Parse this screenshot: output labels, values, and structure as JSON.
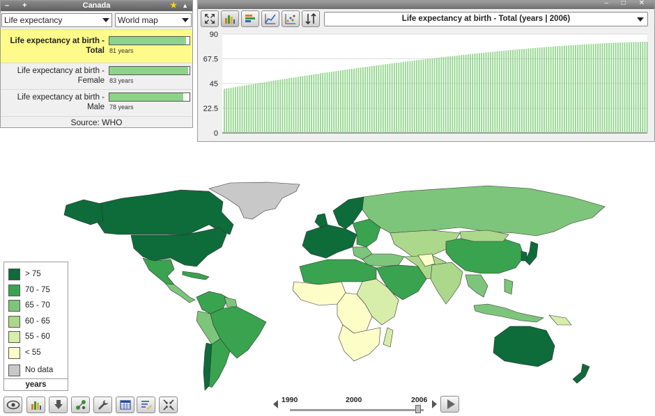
{
  "country_panel": {
    "title": "Canada",
    "indicator_select": "Life expectancy",
    "view_select": "World map",
    "indicators": [
      {
        "label_line1": "Life expectancy at birth -",
        "label_line2": "Total",
        "value_text": "81 years",
        "fill_fraction": 0.96,
        "selected": true
      },
      {
        "label_line1": "Life expectancy at birth -",
        "label_line2": "Female",
        "value_text": "83 years",
        "fill_fraction": 0.98,
        "selected": false
      },
      {
        "label_line1": "Life expectancy at birth -",
        "label_line2": "Male",
        "value_text": "78 years",
        "fill_fraction": 0.92,
        "selected": false
      }
    ],
    "source": "Source: WHO"
  },
  "chart_panel": {
    "title": "Life expectancy at birth - Total (years | 2006)",
    "tool_icons": [
      "fullscreen-icon",
      "bar-chart-icon",
      "horizontal-bar-icon",
      "line-chart-icon",
      "scatter-icon",
      "sort-icon"
    ]
  },
  "chart_data": {
    "type": "bar",
    "title": "Life expectancy at birth - Total (years | 2006)",
    "xlabel": "",
    "ylabel": "",
    "ylim": [
      0,
      90
    ],
    "yticks": [
      "0",
      "22.5",
      "45",
      "67.5",
      "90"
    ],
    "grid": true,
    "bar_color": "#8fd38a",
    "value_range": [
      40,
      83
    ],
    "bar_count": 190,
    "note_values": "approximate sorted ascending values read from gridlines"
  },
  "legend": {
    "items": [
      {
        "label": "> 75",
        "color": "#0e6b3a"
      },
      {
        "label": "70 - 75",
        "color": "#39a34f"
      },
      {
        "label": "65 - 70",
        "color": "#7dc57a"
      },
      {
        "label": "60 - 65",
        "color": "#abd88a"
      },
      {
        "label": "55 - 60",
        "color": "#d7edaa"
      },
      {
        "label": "< 55",
        "color": "#fdfdc8"
      },
      {
        "label": "No data",
        "color": "#c8c8c8"
      }
    ],
    "unit": "years"
  },
  "bottom_toolbar": {
    "icons": [
      "eye-icon",
      "bar-chart-icon",
      "download-icon",
      "network-icon",
      "wrench-icon",
      "table-icon",
      "edit-list-icon",
      "fit-screen-icon"
    ]
  },
  "timeline": {
    "years": [
      "1990",
      "2000",
      "2006"
    ],
    "current_year": "2006"
  }
}
